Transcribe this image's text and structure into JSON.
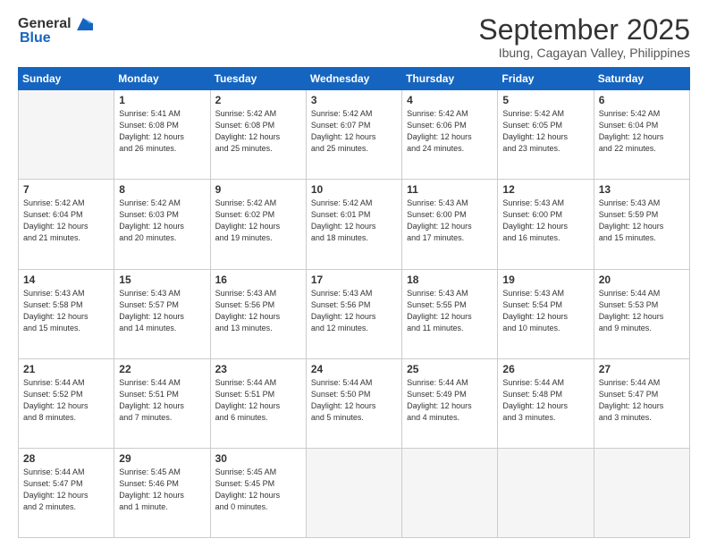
{
  "logo": {
    "general": "General",
    "blue": "Blue"
  },
  "header": {
    "month": "September 2025",
    "location": "Ibung, Cagayan Valley, Philippines"
  },
  "days": [
    "Sunday",
    "Monday",
    "Tuesday",
    "Wednesday",
    "Thursday",
    "Friday",
    "Saturday"
  ],
  "weeks": [
    [
      {
        "num": "",
        "info": ""
      },
      {
        "num": "1",
        "info": "Sunrise: 5:41 AM\nSunset: 6:08 PM\nDaylight: 12 hours\nand 26 minutes."
      },
      {
        "num": "2",
        "info": "Sunrise: 5:42 AM\nSunset: 6:08 PM\nDaylight: 12 hours\nand 25 minutes."
      },
      {
        "num": "3",
        "info": "Sunrise: 5:42 AM\nSunset: 6:07 PM\nDaylight: 12 hours\nand 25 minutes."
      },
      {
        "num": "4",
        "info": "Sunrise: 5:42 AM\nSunset: 6:06 PM\nDaylight: 12 hours\nand 24 minutes."
      },
      {
        "num": "5",
        "info": "Sunrise: 5:42 AM\nSunset: 6:05 PM\nDaylight: 12 hours\nand 23 minutes."
      },
      {
        "num": "6",
        "info": "Sunrise: 5:42 AM\nSunset: 6:04 PM\nDaylight: 12 hours\nand 22 minutes."
      }
    ],
    [
      {
        "num": "7",
        "info": "Sunrise: 5:42 AM\nSunset: 6:04 PM\nDaylight: 12 hours\nand 21 minutes."
      },
      {
        "num": "8",
        "info": "Sunrise: 5:42 AM\nSunset: 6:03 PM\nDaylight: 12 hours\nand 20 minutes."
      },
      {
        "num": "9",
        "info": "Sunrise: 5:42 AM\nSunset: 6:02 PM\nDaylight: 12 hours\nand 19 minutes."
      },
      {
        "num": "10",
        "info": "Sunrise: 5:42 AM\nSunset: 6:01 PM\nDaylight: 12 hours\nand 18 minutes."
      },
      {
        "num": "11",
        "info": "Sunrise: 5:43 AM\nSunset: 6:00 PM\nDaylight: 12 hours\nand 17 minutes."
      },
      {
        "num": "12",
        "info": "Sunrise: 5:43 AM\nSunset: 6:00 PM\nDaylight: 12 hours\nand 16 minutes."
      },
      {
        "num": "13",
        "info": "Sunrise: 5:43 AM\nSunset: 5:59 PM\nDaylight: 12 hours\nand 15 minutes."
      }
    ],
    [
      {
        "num": "14",
        "info": "Sunrise: 5:43 AM\nSunset: 5:58 PM\nDaylight: 12 hours\nand 15 minutes."
      },
      {
        "num": "15",
        "info": "Sunrise: 5:43 AM\nSunset: 5:57 PM\nDaylight: 12 hours\nand 14 minutes."
      },
      {
        "num": "16",
        "info": "Sunrise: 5:43 AM\nSunset: 5:56 PM\nDaylight: 12 hours\nand 13 minutes."
      },
      {
        "num": "17",
        "info": "Sunrise: 5:43 AM\nSunset: 5:56 PM\nDaylight: 12 hours\nand 12 minutes."
      },
      {
        "num": "18",
        "info": "Sunrise: 5:43 AM\nSunset: 5:55 PM\nDaylight: 12 hours\nand 11 minutes."
      },
      {
        "num": "19",
        "info": "Sunrise: 5:43 AM\nSunset: 5:54 PM\nDaylight: 12 hours\nand 10 minutes."
      },
      {
        "num": "20",
        "info": "Sunrise: 5:44 AM\nSunset: 5:53 PM\nDaylight: 12 hours\nand 9 minutes."
      }
    ],
    [
      {
        "num": "21",
        "info": "Sunrise: 5:44 AM\nSunset: 5:52 PM\nDaylight: 12 hours\nand 8 minutes."
      },
      {
        "num": "22",
        "info": "Sunrise: 5:44 AM\nSunset: 5:51 PM\nDaylight: 12 hours\nand 7 minutes."
      },
      {
        "num": "23",
        "info": "Sunrise: 5:44 AM\nSunset: 5:51 PM\nDaylight: 12 hours\nand 6 minutes."
      },
      {
        "num": "24",
        "info": "Sunrise: 5:44 AM\nSunset: 5:50 PM\nDaylight: 12 hours\nand 5 minutes."
      },
      {
        "num": "25",
        "info": "Sunrise: 5:44 AM\nSunset: 5:49 PM\nDaylight: 12 hours\nand 4 minutes."
      },
      {
        "num": "26",
        "info": "Sunrise: 5:44 AM\nSunset: 5:48 PM\nDaylight: 12 hours\nand 3 minutes."
      },
      {
        "num": "27",
        "info": "Sunrise: 5:44 AM\nSunset: 5:47 PM\nDaylight: 12 hours\nand 3 minutes."
      }
    ],
    [
      {
        "num": "28",
        "info": "Sunrise: 5:44 AM\nSunset: 5:47 PM\nDaylight: 12 hours\nand 2 minutes."
      },
      {
        "num": "29",
        "info": "Sunrise: 5:45 AM\nSunset: 5:46 PM\nDaylight: 12 hours\nand 1 minute."
      },
      {
        "num": "30",
        "info": "Sunrise: 5:45 AM\nSunset: 5:45 PM\nDaylight: 12 hours\nand 0 minutes."
      },
      {
        "num": "",
        "info": ""
      },
      {
        "num": "",
        "info": ""
      },
      {
        "num": "",
        "info": ""
      },
      {
        "num": "",
        "info": ""
      }
    ]
  ]
}
